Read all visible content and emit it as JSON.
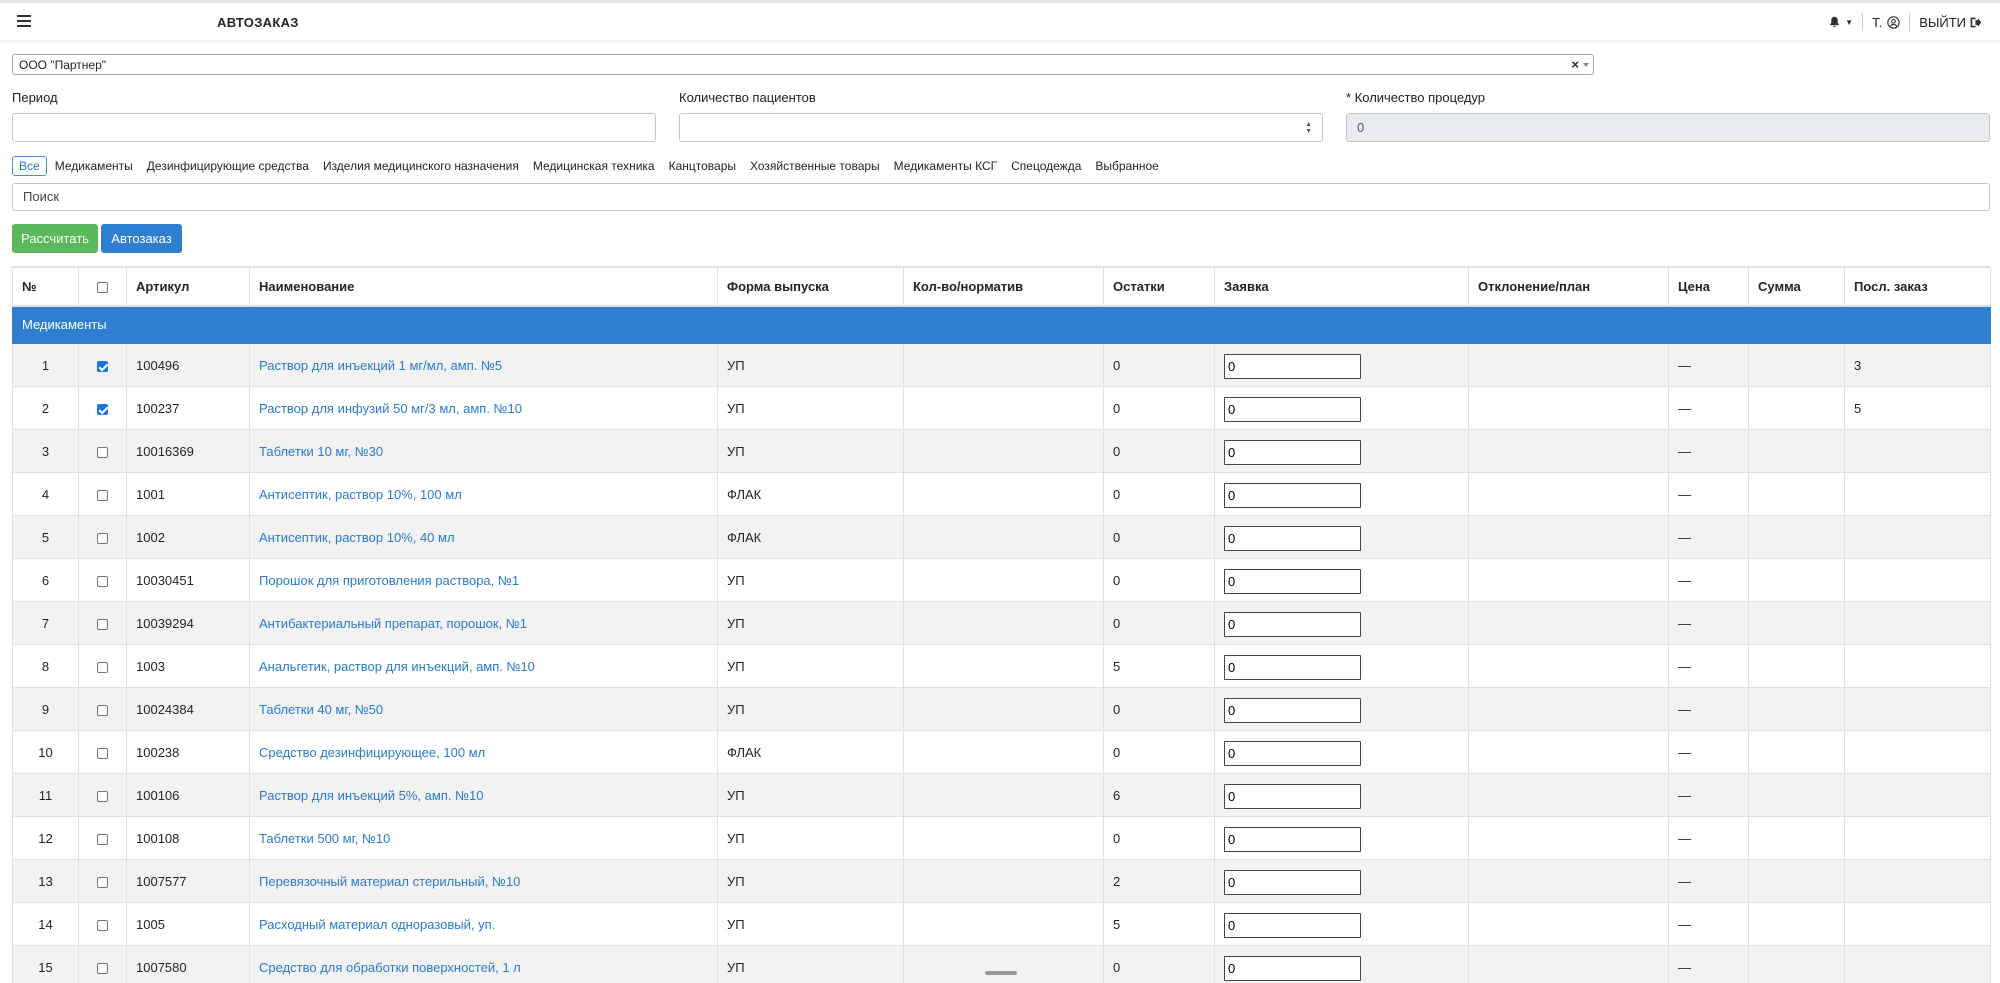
{
  "header": {
    "title": "АВТОЗАКАЗ",
    "user": "Т.",
    "logout": "ВЫЙТИ"
  },
  "org_select": {
    "value": "ООО \"Партнер\"",
    "clear": "×"
  },
  "fields": {
    "period_label": "Период",
    "period_value": "",
    "patients_label": "Количество пациентов",
    "patients_value": "",
    "procedures_label": "* Количество процедур",
    "procedures_value": "0"
  },
  "categories": [
    "Все",
    "Медикаменты",
    "Дезинфицирующие средства",
    "Изделия медицинского назначения",
    "Медицинская техника",
    "Канцтовары",
    "Хозяйственные товары",
    "Медикаменты КСГ",
    "Спецодежда",
    "Выбранное"
  ],
  "search": {
    "placeholder": "Поиск"
  },
  "buttons": {
    "calculate": "Рассчитать",
    "autoorder": "Автозаказ"
  },
  "table": {
    "headers": [
      "№",
      "",
      "Артикул",
      "Наименование",
      "Форма выпуска",
      "Кол-во/норматив",
      "Остатки",
      "Заявка",
      "Отклонение/план",
      "Цена",
      "Сумма",
      "Посл. заказ"
    ],
    "group": "Медикаменты",
    "rows": [
      {
        "n": "1",
        "checked": true,
        "article": "100496",
        "name": "Раствор для инъекций 1 мг/мл, амп. №5",
        "form": "УП",
        "norm": "",
        "stock": "0",
        "order": "0",
        "dev": "",
        "price": "—",
        "sum": "",
        "last": "3"
      },
      {
        "n": "2",
        "checked": true,
        "article": "100237",
        "name": "Раствор для инфузий 50 мг/3 мл, амп. №10",
        "form": "УП",
        "norm": "",
        "stock": "0",
        "order": "0",
        "dev": "",
        "price": "—",
        "sum": "",
        "last": "5"
      },
      {
        "n": "3",
        "checked": false,
        "article": "10016369",
        "name": "Таблетки 10 мг, №30",
        "form": "УП",
        "norm": "",
        "stock": "0",
        "order": "0",
        "dev": "",
        "price": "—",
        "sum": "",
        "last": ""
      },
      {
        "n": "4",
        "checked": false,
        "article": "1001",
        "name": "Антисептик, раствор 10%, 100 мл",
        "form": "ФЛАК",
        "norm": "",
        "stock": "0",
        "order": "0",
        "dev": "",
        "price": "—",
        "sum": "",
        "last": ""
      },
      {
        "n": "5",
        "checked": false,
        "article": "1002",
        "name": "Антисептик, раствор 10%, 40 мл",
        "form": "ФЛАК",
        "norm": "",
        "stock": "0",
        "order": "0",
        "dev": "",
        "price": "—",
        "sum": "",
        "last": ""
      },
      {
        "n": "6",
        "checked": false,
        "article": "10030451",
        "name": "Порошок для приготовления раствора, №1",
        "form": "УП",
        "norm": "",
        "stock": "0",
        "order": "0",
        "dev": "",
        "price": "—",
        "sum": "",
        "last": ""
      },
      {
        "n": "7",
        "checked": false,
        "article": "10039294",
        "name": "Антибактериальный препарат, порошок, №1",
        "form": "УП",
        "norm": "",
        "stock": "0",
        "order": "0",
        "dev": "",
        "price": "—",
        "sum": "",
        "last": ""
      },
      {
        "n": "8",
        "checked": false,
        "article": "1003",
        "name": "Анальгетик, раствор для инъекций, амп. №10",
        "form": "УП",
        "norm": "",
        "stock": "5",
        "order": "0",
        "dev": "",
        "price": "—",
        "sum": "",
        "last": ""
      },
      {
        "n": "9",
        "checked": false,
        "article": "10024384",
        "name": "Таблетки 40 мг, №50",
        "form": "УП",
        "norm": "",
        "stock": "0",
        "order": "0",
        "dev": "",
        "price": "—",
        "sum": "",
        "last": ""
      },
      {
        "n": "10",
        "checked": false,
        "article": "100238",
        "name": "Средство дезинфицирующее, 100 мл",
        "form": "ФЛАК",
        "norm": "",
        "stock": "0",
        "order": "0",
        "dev": "",
        "price": "—",
        "sum": "",
        "last": ""
      },
      {
        "n": "11",
        "checked": false,
        "article": "100106",
        "name": "Раствор для инъекций 5%, амп. №10",
        "form": "УП",
        "norm": "",
        "stock": "6",
        "order": "0",
        "dev": "",
        "price": "—",
        "sum": "",
        "last": ""
      },
      {
        "n": "12",
        "checked": false,
        "article": "100108",
        "name": "Таблетки 500 мг, №10",
        "form": "УП",
        "norm": "",
        "stock": "0",
        "order": "0",
        "dev": "",
        "price": "—",
        "sum": "",
        "last": ""
      },
      {
        "n": "13",
        "checked": false,
        "article": "1007577",
        "name": "Перевязочный материал стерильный, №10",
        "form": "УП",
        "norm": "",
        "stock": "2",
        "order": "0",
        "dev": "",
        "price": "—",
        "sum": "",
        "last": ""
      },
      {
        "n": "14",
        "checked": false,
        "article": "1005",
        "name": "Расходный материал одноразовый, уп.",
        "form": "УП",
        "norm": "",
        "stock": "5",
        "order": "0",
        "dev": "",
        "price": "—",
        "sum": "",
        "last": ""
      },
      {
        "n": "15",
        "checked": false,
        "article": "1007580",
        "name": "Средство для обработки поверхностей, 1 л",
        "form": "УП",
        "norm": "",
        "stock": "0",
        "order": "0",
        "dev": "",
        "price": "—",
        "sum": "",
        "last": ""
      }
    ]
  },
  "colors": {
    "accent": "#2f7fd1",
    "success": "#5cb85c",
    "link": "#2b7ad0"
  }
}
